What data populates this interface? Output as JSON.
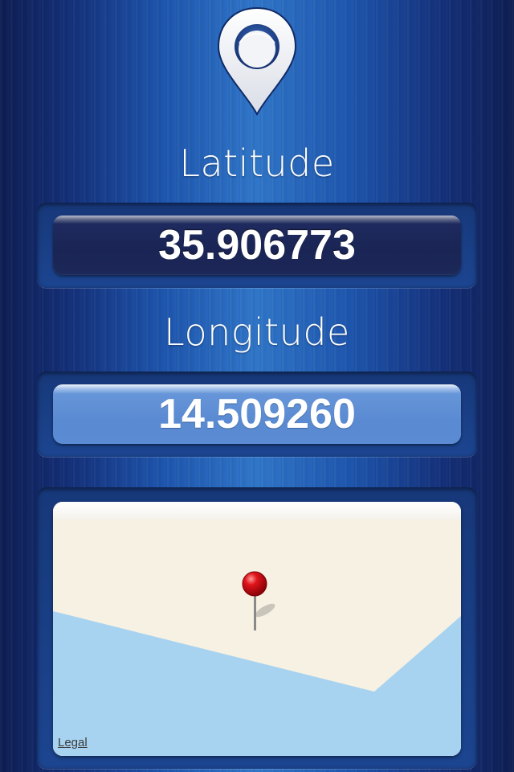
{
  "logo": {
    "icon": "location-pin-icon"
  },
  "latitude": {
    "label": "Latitude",
    "value": "35.906773"
  },
  "longitude": {
    "label": "Longitude",
    "value": "14.509260"
  },
  "map": {
    "legal_link": "Legal",
    "marker_icon": "red-pushpin-icon",
    "colors": {
      "land": "#f6f1e3",
      "water": "#a7d3f0",
      "marker": "#e0141b"
    }
  },
  "colors": {
    "background": "#1d55ad",
    "latitude_field": "#1a2555",
    "longitude_field": "#5a8ad2",
    "label_text": "#ffffff"
  }
}
